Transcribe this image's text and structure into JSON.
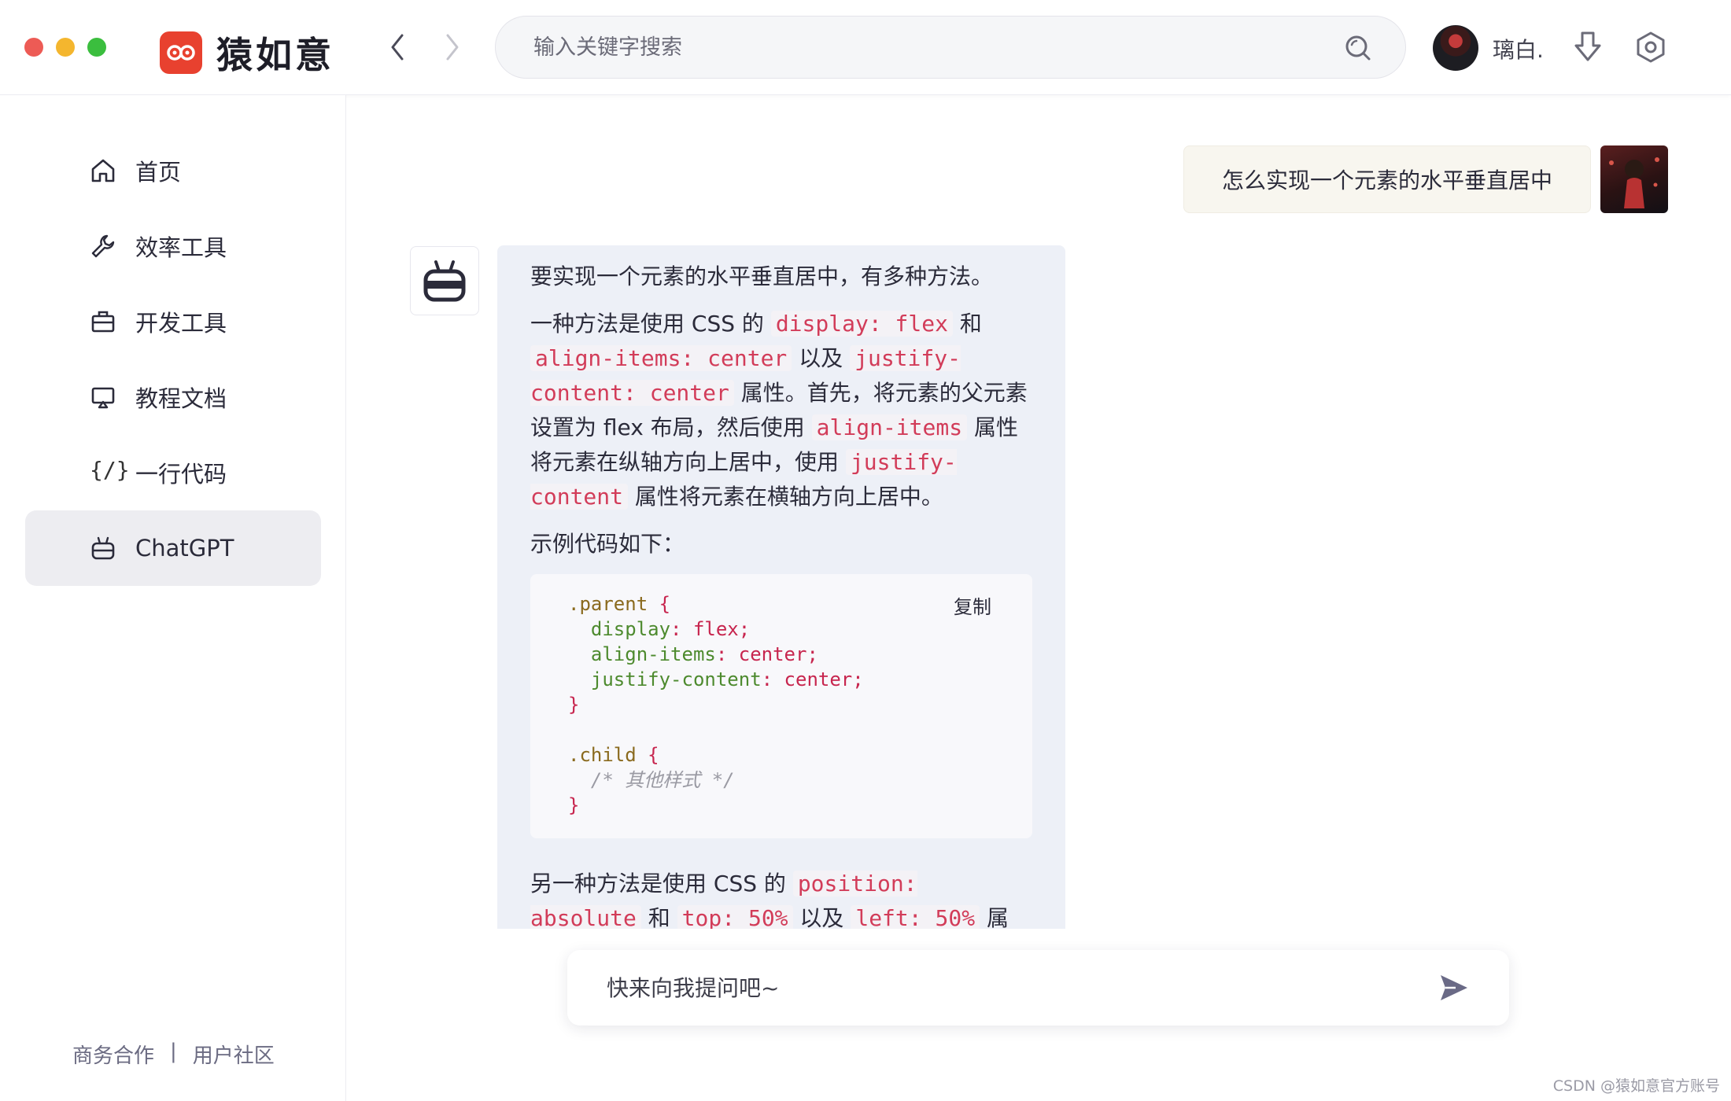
{
  "window": {
    "traffic_lights": [
      "#ed5b55",
      "#f4b62e",
      "#3bbe3e"
    ]
  },
  "header": {
    "brand_name": "猿如意",
    "brand_color": "#e8412f",
    "search_placeholder": "输入关键字搜索",
    "username": "璃白.",
    "icons": [
      "chevron-left-icon",
      "chevron-right-icon",
      "search-icon",
      "download-icon",
      "settings-icon"
    ]
  },
  "sidebar": {
    "items": [
      {
        "label": "首页",
        "icon": "home-icon",
        "active": false
      },
      {
        "label": "效率工具",
        "icon": "wrench-icon",
        "active": false
      },
      {
        "label": "开发工具",
        "icon": "briefcase-icon",
        "active": false
      },
      {
        "label": "教程文档",
        "icon": "monitor-icon",
        "active": false
      },
      {
        "label": "一行代码",
        "icon": "code-icon",
        "icon_text": "{/}",
        "active": false
      },
      {
        "label": "ChatGPT",
        "icon": "robot-icon",
        "active": true
      }
    ],
    "footer": {
      "business": "商务合作",
      "separator": "|",
      "community": "用户社区"
    }
  },
  "chat": {
    "user_question": "怎么实现一个元素的水平垂直居中",
    "answer": {
      "intro": "要实现一个元素的水平垂直居中，有多种方法。",
      "p1_a": "一种方法是使用 CSS 的 ",
      "p1_code1": "display: flex",
      "p1_b": " 和 ",
      "p1_code2": "align-items: center",
      "p1_c": " 以及 ",
      "p1_code3": "justify-content: center",
      "p1_d": " 属性。首先，将元素的父元素设置为 flex 布局，然后使用 ",
      "p1_code4": "align-items",
      "p1_e": " 属性将元素在纵轴方向上居中，使用 ",
      "p1_code5": "justify-content",
      "p1_f": " 属性将元素在横轴方向上居中。",
      "example_label": "示例代码如下：",
      "code": {
        "copy_label": "复制",
        "l1_sel": ".parent",
        "l1_brace": " {",
        "l2_prop": "  display",
        "l2_val": ": flex;",
        "l3_prop": "  align-items",
        "l3_val": ": center;",
        "l4_prop": "  justify-content",
        "l4_val": ": center;",
        "l5_brace": "}",
        "l7_sel": ".child",
        "l7_brace": " {",
        "l8_comment": "  /* 其他样式 */",
        "l9_brace": "}"
      },
      "p2_a": "另一种方法是使用 CSS 的 ",
      "p2_code1": "position: absolute",
      "p2_b": " 和 ",
      "p2_code2": "top: 50%",
      "p2_c": " 以及 ",
      "p2_code3": "left: 50%",
      "p2_d": " 属性。首先，将"
    }
  },
  "composer": {
    "placeholder": "快来向我提问吧~"
  },
  "watermark": "CSDN @猿如意官方账号"
}
